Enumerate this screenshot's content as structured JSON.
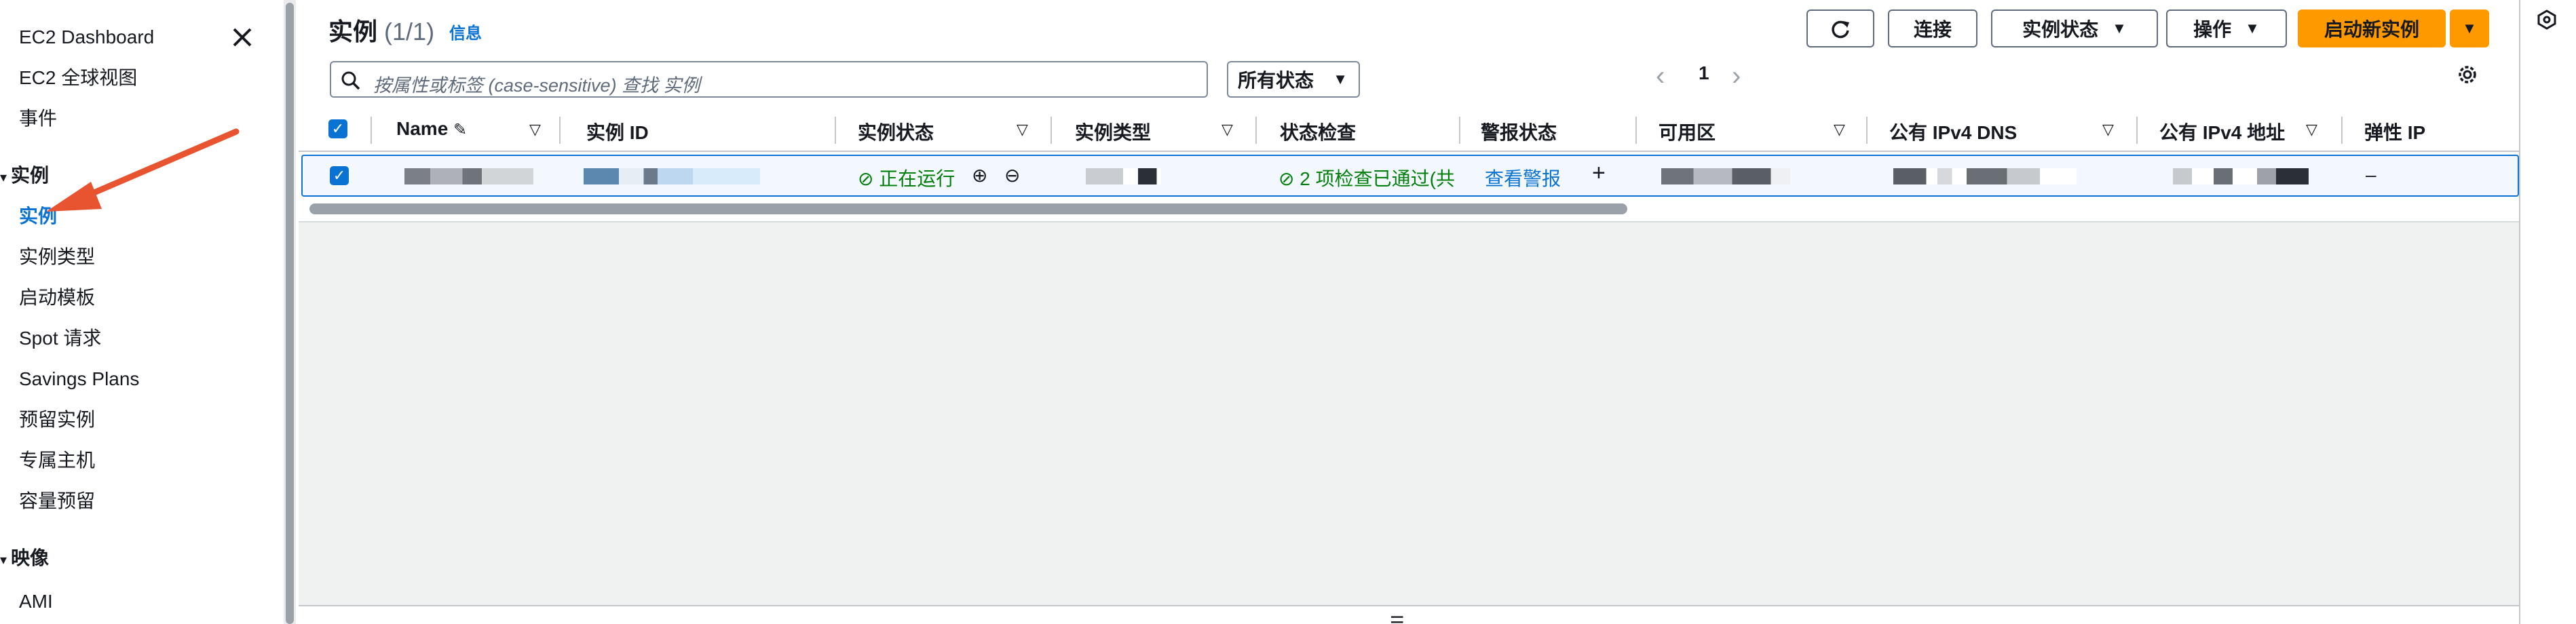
{
  "sidebar": {
    "items": [
      {
        "label": "EC2 Dashboard"
      },
      {
        "label": "EC2 全球视图"
      },
      {
        "label": "事件"
      }
    ],
    "instances_section": "实例",
    "instances_items": [
      {
        "label": "实例"
      },
      {
        "label": "实例类型"
      },
      {
        "label": "启动模板"
      },
      {
        "label": "Spot 请求"
      },
      {
        "label": "Savings Plans"
      },
      {
        "label": "预留实例"
      },
      {
        "label": "专属主机"
      },
      {
        "label": "容量预留"
      }
    ],
    "images_section": "映像",
    "images_items": [
      {
        "label": "AMI"
      }
    ]
  },
  "header": {
    "title": "实例",
    "count": "(1/1)",
    "info": "信息"
  },
  "toolbar": {
    "connect": "连接",
    "instance_state": "实例状态",
    "actions": "操作",
    "launch": "启动新实例"
  },
  "search": {
    "placeholder": "按属性或标签 (case-sensitive) 查找 实例"
  },
  "filter": {
    "selected": "所有状态"
  },
  "pagination": {
    "page": "1"
  },
  "table": {
    "columns": [
      "Name",
      "实例 ID",
      "实例状态",
      "实例类型",
      "状态检查",
      "警报状态",
      "可用区",
      "公有 IPv4 DNS",
      "公有 IPv4 地址",
      "弹性 IP"
    ],
    "row": {
      "state": "正在运行",
      "status_check": "2 项检查已通过(共",
      "alarm": "查看警报",
      "elastic_ip": "–"
    }
  },
  "colors": {
    "accent": "#0972d3",
    "primary_button": "#ff9900",
    "success": "#037f0c",
    "annotation_arrow": "#e8542f"
  }
}
